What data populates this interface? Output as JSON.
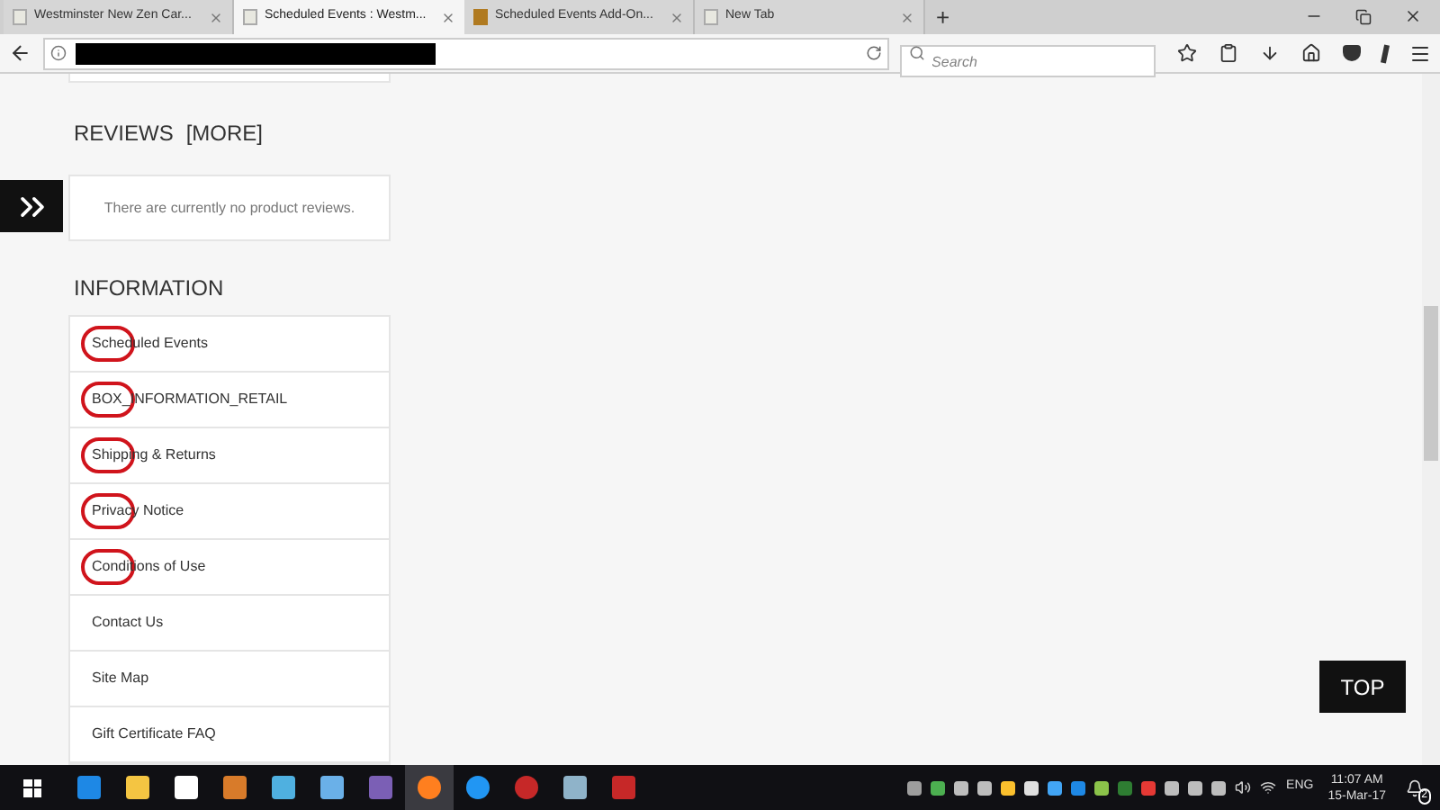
{
  "tabs": [
    {
      "title": "Westminster New Zen Car...",
      "selected": false
    },
    {
      "title": "Scheduled Events : Westm...",
      "selected": true
    },
    {
      "title": "Scheduled Events Add-On...",
      "selected": false
    },
    {
      "title": "New Tab",
      "selected": false
    }
  ],
  "new_tab_button": "+",
  "address_bar": {
    "redacted": true
  },
  "search": {
    "placeholder": "Search"
  },
  "reviews": {
    "heading": "REVIEWS",
    "more_link": "[MORE]",
    "message": "There are currently no product reviews."
  },
  "information": {
    "heading": "INFORMATION",
    "items": [
      {
        "label": "Scheduled Events",
        "circled": true
      },
      {
        "label": "BOX_INFORMATION_RETAIL",
        "circled": true
      },
      {
        "label": "Shipping & Returns",
        "circled": true
      },
      {
        "label": "Privacy Notice",
        "circled": true
      },
      {
        "label": "Conditions of Use",
        "circled": true
      },
      {
        "label": "Contact Us",
        "circled": false
      },
      {
        "label": "Site Map",
        "circled": false
      },
      {
        "label": "Gift Certificate FAQ",
        "circled": false
      }
    ]
  },
  "top_button": "TOP",
  "taskbar": {
    "language": "ENG",
    "time": "11:07 AM",
    "date": "15-Mar-17",
    "notification_count": "2"
  }
}
